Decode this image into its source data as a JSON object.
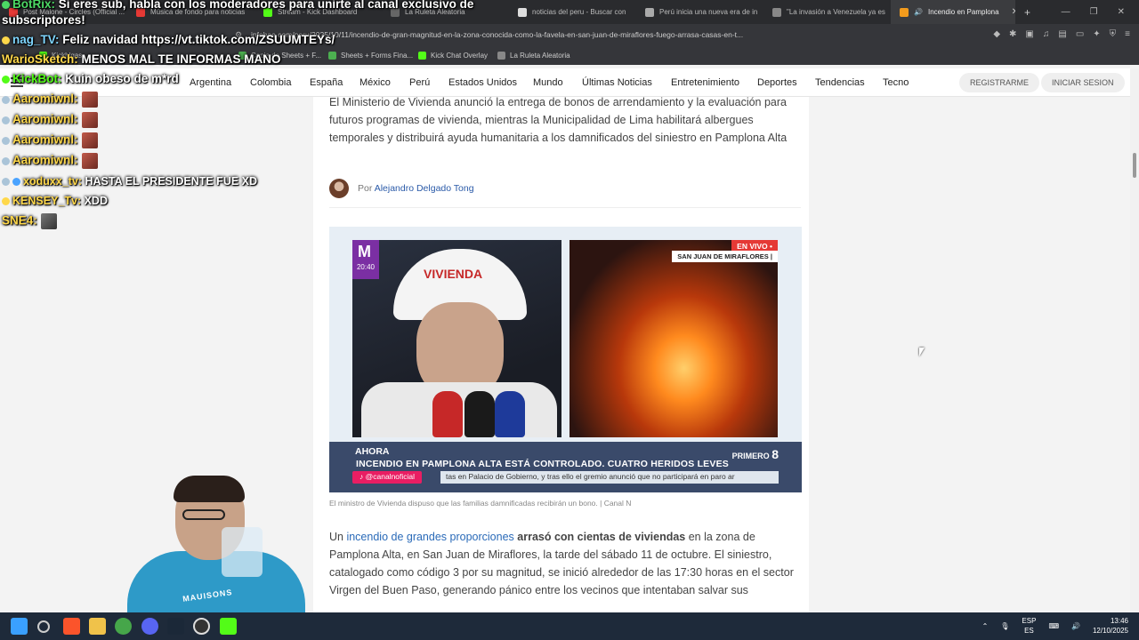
{
  "browser": {
    "tabs": [
      {
        "label": "Post Malone - Circles (Official ..."
      },
      {
        "label": "Música de fondo para noticias"
      },
      {
        "label": "Stream - Kick Dashboard"
      },
      {
        "label": "La Ruleta Aleatoria"
      },
      {
        "label": "noticias del peru - Buscar con"
      },
      {
        "label": "Perú inicia una nueva era de in"
      },
      {
        "label": "\"La invasión a Venezuela ya es"
      },
      {
        "label": "Incendio en Pamplona"
      }
    ],
    "url": "infobae.com/peru/2025/10/11/incendio-de-gran-magnitud-en-la-zona-conocida-como-la-favela-en-san-juan-de-miraflores-fuego-arrasa-casas-en-t...",
    "bookmarks": [
      "Kickhlgas",
      "Copia de Sheets + F...",
      "Sheets + Forms Fina...",
      "Kick Chat Overlay",
      "La Ruleta Aleatoria"
    ]
  },
  "site_nav": {
    "items": [
      "Argentina",
      "Colombia",
      "España",
      "México",
      "Perú",
      "Estados Unidos",
      "Mundo",
      "Últimas Noticias",
      "Entretenimiento",
      "Deportes",
      "Tendencias",
      "Tecno"
    ],
    "register": "REGISTRARME",
    "login": "INICIAR SESION"
  },
  "article": {
    "intro": "El Ministerio de Vivienda anunció la entrega de bonos de arrendamiento y la evaluación para futuros programas de vivienda, mientras la Municipalidad de Lima habilitará albergues temporales y distribuirá ayuda humanitaria a los damnificados del siniestro en Pamplona Alta",
    "author_prefix": "Por",
    "author": "Alejandro Delgado Tong",
    "media": {
      "helmet_text": "VIVIENDA",
      "time": "20:40",
      "live": "EN VIVO •",
      "location": "SAN JUAN DE MIRAFLORES |",
      "ticker_label": "AHORA",
      "ticker_headline": "INCENDIO EN PAMPLONA ALTA ESTÁ CONTROLADO. CUATRO  HERIDOS LEVES",
      "handle": "@canalnoficial",
      "crawl": "tas en Palacio de Gobierno, y tras ello el gremio anunció que no participará en paro ar",
      "brand_top": "PRIMERO",
      "brand_num": "8"
    },
    "caption": "El ministro de Vivienda dispuso que las familias damnificadas recibirán un bono. | Canal N",
    "body_link": "incendio de grandes proporciones",
    "body_bold": "arrasó con cientas de viviendas",
    "body_rest": " en la zona de Pamplona Alta, en San Juan de Miraflores, la tarde del sábado 11 de octubre. El siniestro, catalogado como código 3 por su magnitud, se inició alrededor de las 17:30 horas en el sector Virgen del Buen Paso, generando pánico entre los vecinos que intentaban salvar sus"
  },
  "chat": [
    {
      "user": "BotRix:",
      "text": " Si eres sub, habla con los moderadores para unirte al canal exclusivo de",
      "color": "#4cd964"
    },
    {
      "user": "",
      "text": "subscriptores!",
      "color": "#ffffff"
    },
    {
      "user": "nag_TV:",
      "text": " Feliz navidad https://vt.tiktok.com/ZSUUMTEYs/",
      "color": "#7fd6ff"
    },
    {
      "user": "WarioSketch:",
      "text": " MENOS MAL TE INFORMAS MANO",
      "color": "#ffd84a"
    },
    {
      "user": "KickBot:",
      "text": " Kuin obeso de m*rd",
      "color": "#53fc18"
    },
    {
      "user": "Aaromiwnl:",
      "text": "",
      "color": "#ffd84a"
    },
    {
      "user": "Aaromiwnl:",
      "text": "",
      "color": "#ffd84a"
    },
    {
      "user": "Aaromiwnl:",
      "text": "",
      "color": "#ffd84a"
    },
    {
      "user": "Aaromiwnl:",
      "text": "",
      "color": "#ffd84a"
    },
    {
      "user": "xoduxx_tv:",
      "text": " HASTA EL PRESIDENTE FUE XD",
      "color": "#ffd84a"
    },
    {
      "user": "KENSEY_Tv:",
      "text": " XDD",
      "color": "#ffd84a"
    },
    {
      "user": "SNE4:",
      "text": "",
      "color": "#ffd84a"
    }
  ],
  "webcam": {
    "shirt_text": "MAUISONS"
  },
  "taskbar": {
    "lang_top": "ESP",
    "lang_bottom": "ES",
    "time": "13:46",
    "date": "12/10/2025"
  }
}
